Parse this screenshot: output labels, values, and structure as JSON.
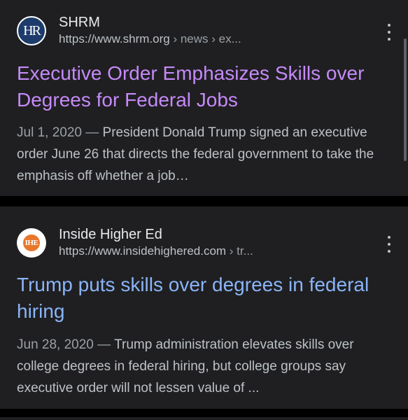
{
  "results": [
    {
      "site_name": "SHRM",
      "url_base": "https://www.shrm.org",
      "url_crumbs": " › news › ex...",
      "favicon_label": "HR",
      "title": "Executive Order Emphasizes Skills over Degrees for Federal Jobs",
      "date": "Jul 1, 2020",
      "separator": " — ",
      "snippet": "President Donald Trump signed an executive order June 26 that directs the federal government to take the emphasis off whether a job…"
    },
    {
      "site_name": "Inside Higher Ed",
      "url_base": "https://www.insidehighered.com",
      "url_crumbs": " › tr...",
      "favicon_label": "IHE",
      "title": "Trump puts skills over degrees in federal hiring",
      "date": "Jun 28, 2020",
      "separator": " — ",
      "snippet": "Trump administration elevates skills over college degrees in federal hiring, but college groups say executive order will not lessen value of ..."
    }
  ],
  "icons": {
    "more_options": "three-vertical-dots-icon",
    "shrm_favicon": "hr-logo-icon",
    "ihe_favicon": "ihe-logo-icon"
  },
  "colors": {
    "background": "#000000",
    "card": "#1f1f21",
    "visited_title": "#c58af9",
    "link_title": "#8ab4f8",
    "text_primary": "#e8eaed",
    "text_secondary": "#bdc1c6"
  }
}
